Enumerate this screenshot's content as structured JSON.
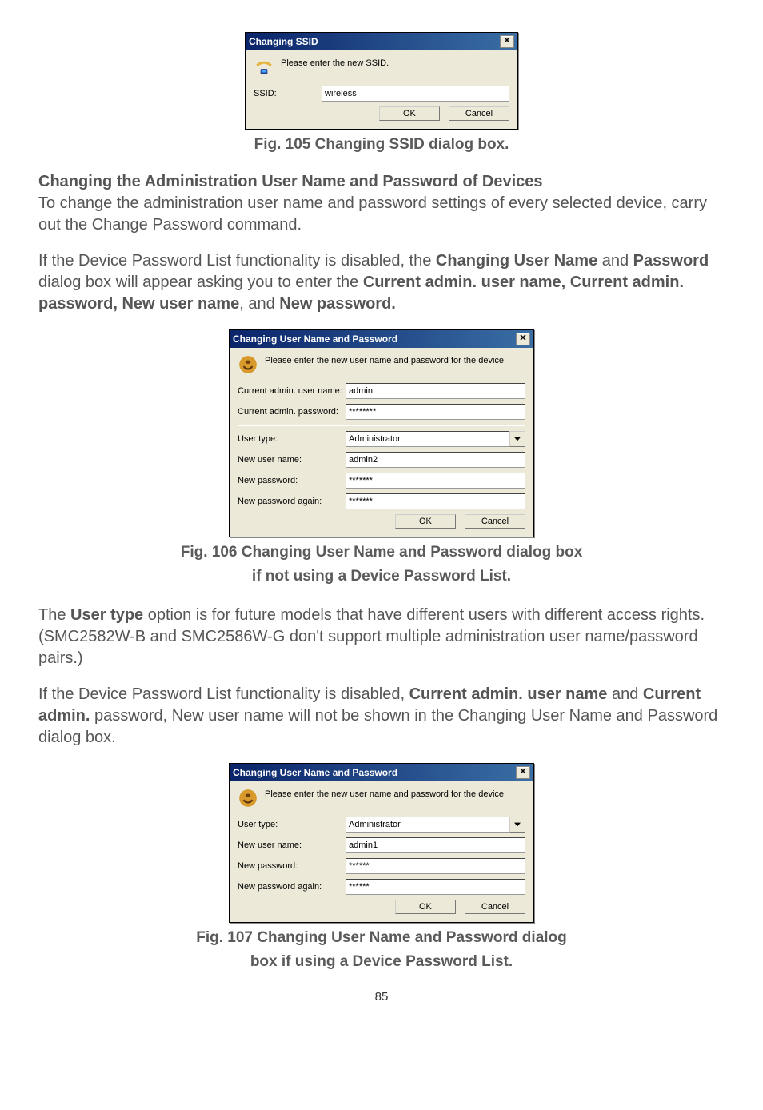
{
  "page_number": "85",
  "fig105": {
    "caption": "Fig. 105 Changing SSID dialog box.",
    "title": "Changing SSID",
    "instruction": "Please enter the new SSID.",
    "ssid_label": "SSID:",
    "ssid_value": "wireless",
    "ok": "OK",
    "cancel": "Cancel"
  },
  "section1": {
    "heading": "Changing the Administration User Name and Password of Devices",
    "p1": "To change the administration user name and password settings of every selected device, carry out the Change Password command.",
    "p2a": "If the Device Password List functionality is disabled, the ",
    "p2b": "Changing User Name",
    "p2c": " and ",
    "p2d": "Password",
    "p2e": " dialog box will appear asking you to enter the ",
    "p2f": "Current admin. user name, Current admin. password, New user name",
    "p2g": ", and ",
    "p2h": "New password."
  },
  "fig106": {
    "caption_line1": "Fig. 106 Changing User Name and Password dialog box",
    "caption_line2": "if not using a Device Password List.",
    "title": "Changing User Name and Password",
    "instruction": "Please enter the new user name and password for the device.",
    "cur_user_label": "Current admin. user name:",
    "cur_user_value": "admin",
    "cur_pwd_label": "Current admin. password:",
    "cur_pwd_value": "********",
    "type_label": "User type:",
    "type_value": "Administrator",
    "new_user_label": "New user name:",
    "new_user_value": "admin2",
    "new_pwd_label": "New password:",
    "new_pwd_value": "*******",
    "new_pwd2_label": "New password again:",
    "new_pwd2_value": "*******",
    "ok": "OK",
    "cancel": "Cancel"
  },
  "section2": {
    "p1a": "The ",
    "p1b": "User type",
    "p1c": " option is for future models that have different users with different access rights. (SMC2582W-B and SMC2586W-G don't support multiple administration user name/password pairs.)",
    "p2a": "If the Device Password List functionality is disabled, ",
    "p2b": "Current admin. user name",
    "p2c": " and ",
    "p2d": "Current admin.",
    "p2e": " password, New user name will not be shown in the Changing User Name and Password dialog box."
  },
  "fig107": {
    "caption_line1": "Fig. 107 Changing User Name and Password dialog",
    "caption_line2": "box if using a Device Password List.",
    "title": "Changing User Name and Password",
    "instruction": "Please enter the new user name and password for the device.",
    "type_label": "User type:",
    "type_value": "Administrator",
    "new_user_label": "New user name:",
    "new_user_value": "admin1",
    "new_pwd_label": "New password:",
    "new_pwd_value": "******",
    "new_pwd2_label": "New password again:",
    "new_pwd2_value": "******",
    "ok": "OK",
    "cancel": "Cancel"
  }
}
